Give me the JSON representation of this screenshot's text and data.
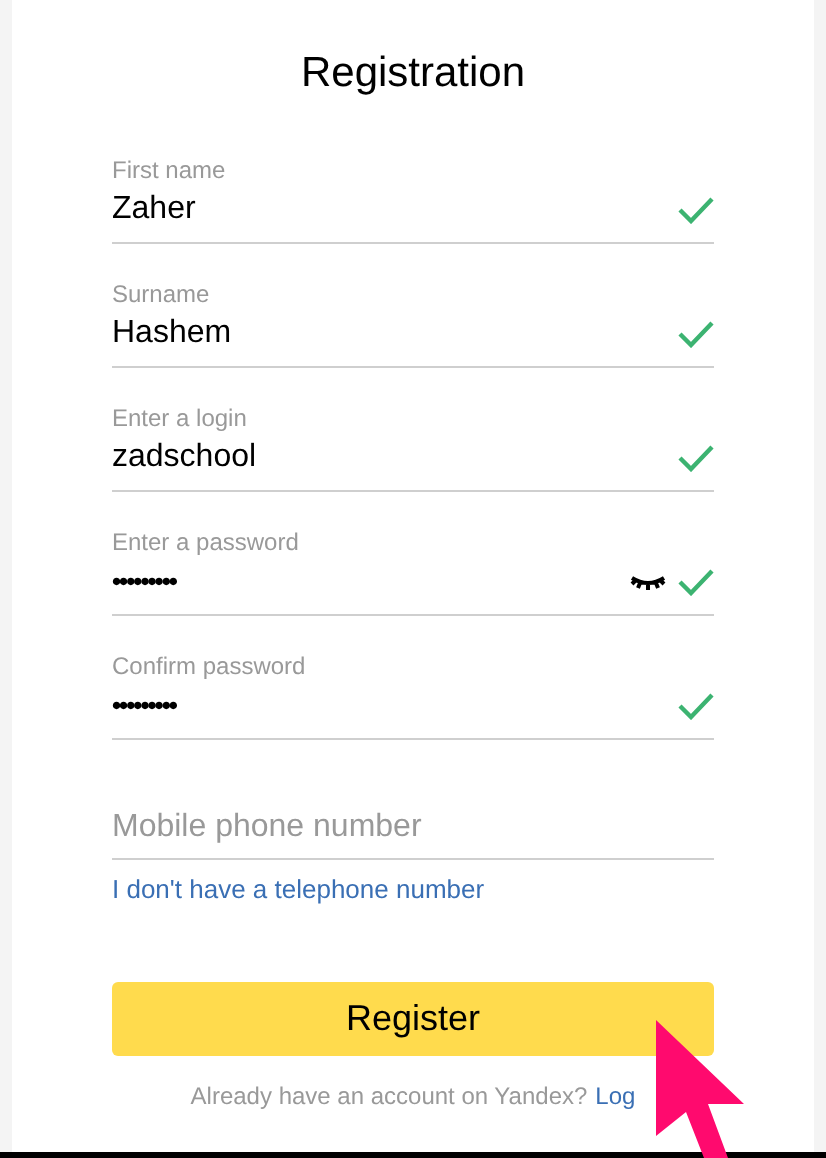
{
  "title": "Registration",
  "fields": [
    {
      "kind": "text",
      "label": "First name",
      "value": "Zaher",
      "valid": true
    },
    {
      "kind": "text",
      "label": "Surname",
      "value": "Hashem",
      "valid": true
    },
    {
      "kind": "text",
      "label": "Enter a login",
      "value": "zadschool",
      "valid": true
    },
    {
      "kind": "password",
      "label": "Enter a password",
      "value": "•••••••••",
      "valid": true,
      "reveal_toggle": true
    },
    {
      "kind": "password",
      "label": "Confirm password",
      "value": "•••••••••",
      "valid": true
    }
  ],
  "phone": {
    "placeholder": "Mobile phone number"
  },
  "no_phone_link": "I don't have a telephone number",
  "register_button": "Register",
  "login_prompt": {
    "text": "Already have an account on Yandex?",
    "link": "Log"
  }
}
